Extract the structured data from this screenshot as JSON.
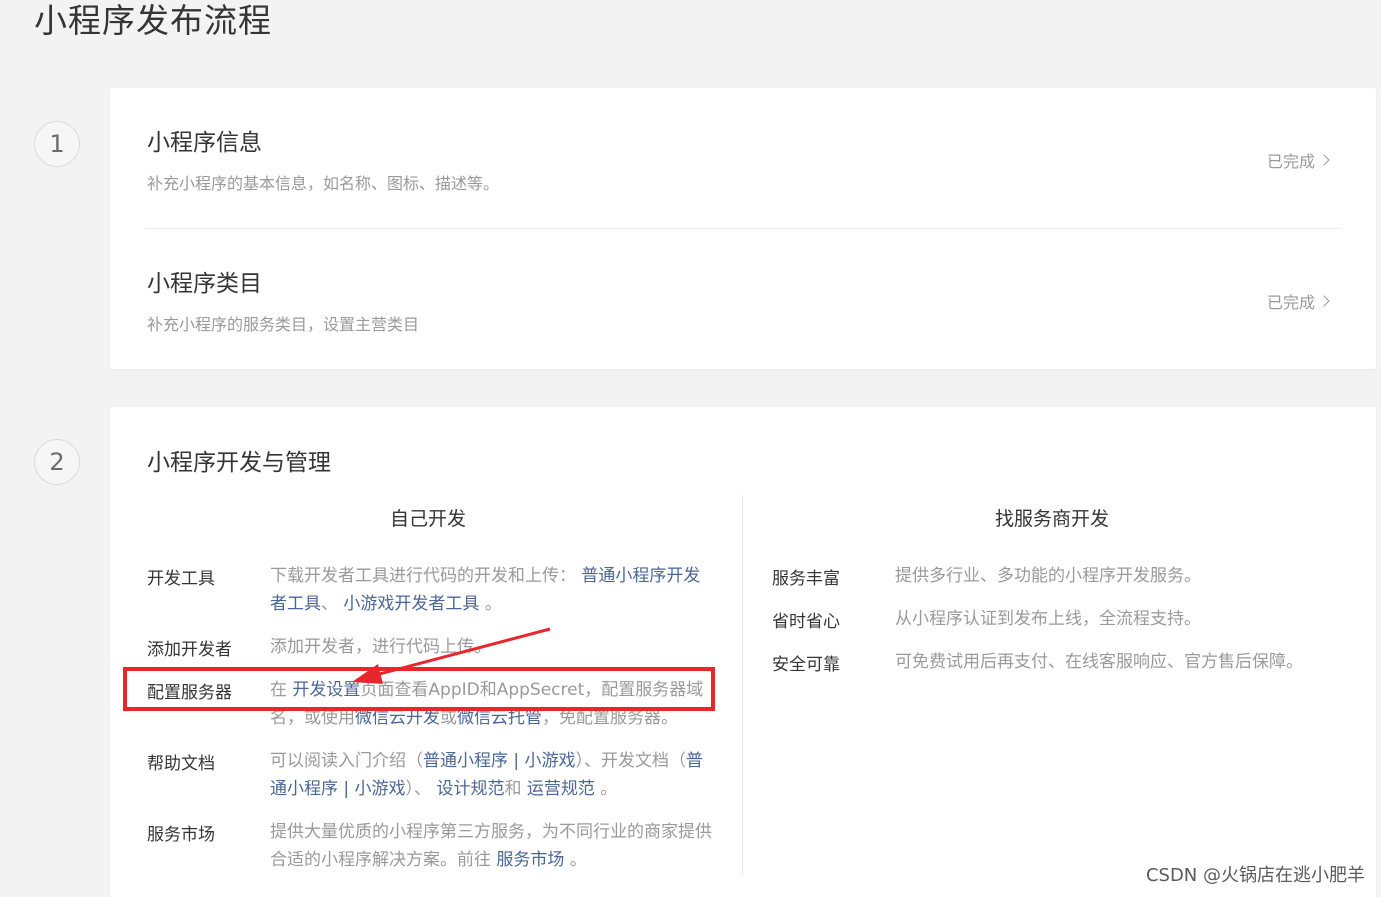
{
  "page": {
    "title": "小程序发布流程"
  },
  "step1": {
    "number": "1",
    "items": [
      {
        "title": "小程序信息",
        "desc": "补充小程序的基本信息，如名称、图标、描述等。",
        "status": "已完成"
      },
      {
        "title": "小程序类目",
        "desc": "补充小程序的服务类目，设置主营类目",
        "status": "已完成"
      }
    ]
  },
  "step2": {
    "number": "2",
    "title": "小程序开发与管理",
    "self_dev": {
      "heading": "自己开发",
      "tools": {
        "label": "开发工具",
        "pre": "下载开发者工具进行代码的开发和上传：",
        "link1": "普通小程序开发者工具",
        "mid": "、",
        "link2": "小游戏开发者工具",
        "post": "。"
      },
      "add_dev": {
        "label": "添加开发者",
        "text": "添加开发者，进行代码上传。"
      },
      "server": {
        "label": "配置服务器",
        "pre": "在",
        "link1": "开发设置",
        "mid1": "页面查看AppID和AppSecret，配置服务器域名，或使用",
        "link2": "微信云开发",
        "mid2": "或",
        "link3": "微信云托管",
        "post": "，免配置服务器。"
      },
      "docs": {
        "label": "帮助文档",
        "pre": "可以阅读入门介绍（",
        "link1": "普通小程序",
        "sep": " | ",
        "link2": "小游戏",
        "mid": "）、开发文档（",
        "link3": "普通小程序",
        "link4": "小游戏",
        "mid2": "）、",
        "link5": "设计规范",
        "and": "和",
        "link6": "运营规范",
        "post": "。"
      },
      "market": {
        "label": "服务市场",
        "pre": "提供大量优质的小程序第三方服务，为不同行业的商家提供合适的小程序解决方案。前往",
        "link": "服务市场",
        "post": "。"
      }
    },
    "vendor_dev": {
      "heading": "找服务商开发",
      "rows": [
        {
          "label": "服务丰富",
          "text": "提供多行业、多功能的小程序开发服务。"
        },
        {
          "label": "省时省心",
          "text": "从小程序认证到发布上线，全流程支持。"
        },
        {
          "label": "安全可靠",
          "text": "可免费试用后再支付、在线客服响应、官方售后保障。"
        }
      ]
    }
  },
  "annotation": {
    "box_color": "#e8262b"
  },
  "watermark": "CSDN @火锅店在逃小肥羊"
}
